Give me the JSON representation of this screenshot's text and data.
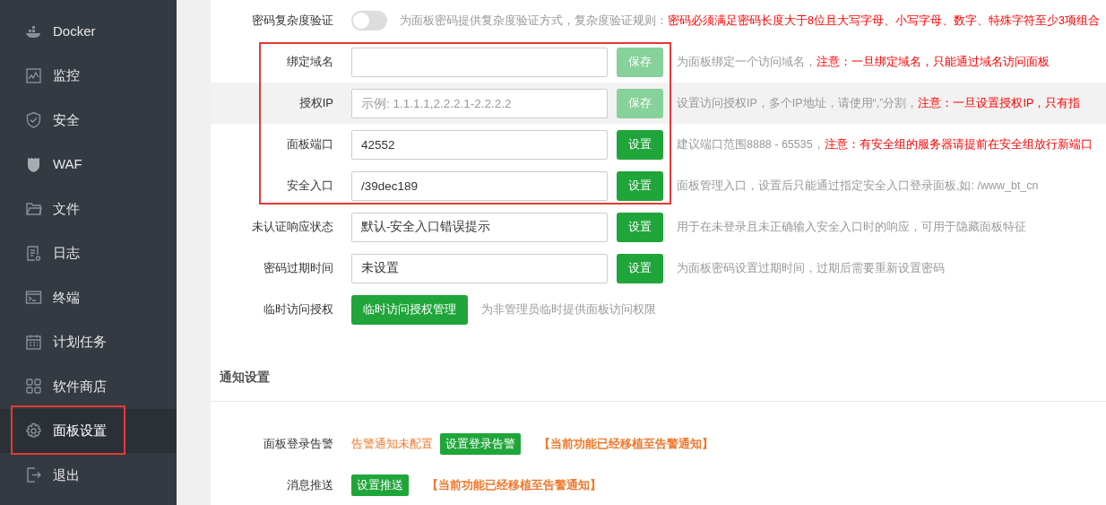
{
  "sidebar": {
    "items": [
      {
        "label": "Docker",
        "selected": false,
        "highlighted": false
      },
      {
        "label": "监控",
        "selected": false,
        "highlighted": false
      },
      {
        "label": "安全",
        "selected": false,
        "highlighted": false
      },
      {
        "label": "WAF",
        "selected": false,
        "highlighted": false
      },
      {
        "label": "文件",
        "selected": false,
        "highlighted": false
      },
      {
        "label": "日志",
        "selected": false,
        "highlighted": false
      },
      {
        "label": "终端",
        "selected": false,
        "highlighted": false
      },
      {
        "label": "计划任务",
        "selected": false,
        "highlighted": false
      },
      {
        "label": "软件商店",
        "selected": false,
        "highlighted": false
      },
      {
        "label": "面板设置",
        "selected": true,
        "highlighted": true
      },
      {
        "label": "退出",
        "selected": false,
        "highlighted": false
      }
    ]
  },
  "settings": [
    {
      "framed": false,
      "rows": [
        {
          "kind": "toggle",
          "label": "密码复杂度验证",
          "on": false,
          "hover": false,
          "desc": "为面板密码提供复杂度验证方式，复杂度验证规则：",
          "note": "密码必须满足密码长度大于8位且大写字母、小写字母、数字、特殊字符至少3项组合"
        }
      ]
    },
    {
      "framed": true,
      "rows": [
        {
          "kind": "input",
          "label": "绑定域名",
          "hover": false,
          "button": "保存",
          "disabled": true,
          "desc": "为面板绑定一个访问域名，",
          "note": "注意：一旦绑定域名，只能通过域名访问面板"
        },
        {
          "kind": "input",
          "label": "授权IP",
          "placeholder": "示例: 1.1.1.1,2.2.2.1-2.2.2.2",
          "hover": true,
          "button": "保存",
          "disabled": true,
          "desc": "设置访问授权IP，多个IP地址，请使用“,”分割，",
          "note": "注意：一旦设置授权IP，只有指"
        },
        {
          "kind": "input",
          "label": "面板端口",
          "value": "42552",
          "hover": false,
          "button": "设置",
          "disabled": false,
          "desc": "建议端口范围8888 - 65535，",
          "note": "注意：有安全组的服务器请提前在安全组放行新端口"
        },
        {
          "kind": "input",
          "label": "安全入口",
          "value": "/39dec189",
          "hover": false,
          "button": "设置",
          "disabled": false,
          "desc": "面板管理入口，设置后只能通过指定安全入口登录面板,如: /www_bt_cn"
        }
      ]
    },
    {
      "framed": false,
      "rows": [
        {
          "kind": "input",
          "label": "未认证响应状态",
          "value": "默认-安全入口错误提示",
          "hover": false,
          "button": "设置",
          "disabled": false,
          "desc": "用于在未登录且未正确输入安全入口时的响应，可用于隐藏面板特征"
        },
        {
          "kind": "input",
          "label": "密码过期时间",
          "value": "未设置",
          "hover": false,
          "button": "设置",
          "disabled": false,
          "desc": "为面板密码设置过期时间，过期后需要重新设置密码"
        },
        {
          "kind": "button",
          "label": "临时访问授权",
          "hover": false,
          "button": "临时访问授权管理",
          "disabled": false,
          "desc": "为非管理员临时提供面板访问权限"
        }
      ]
    }
  ],
  "notify": {
    "title": "通知设置",
    "rows": [
      {
        "label": "面板登录告警",
        "status": "告警通知未配置",
        "button": "设置登录告警",
        "note": "【当前功能已经移植至告警通知】"
      },
      {
        "label": "消息推送",
        "button": "设置推送",
        "note": "【当前功能已经移植至告警通知】"
      }
    ]
  }
}
